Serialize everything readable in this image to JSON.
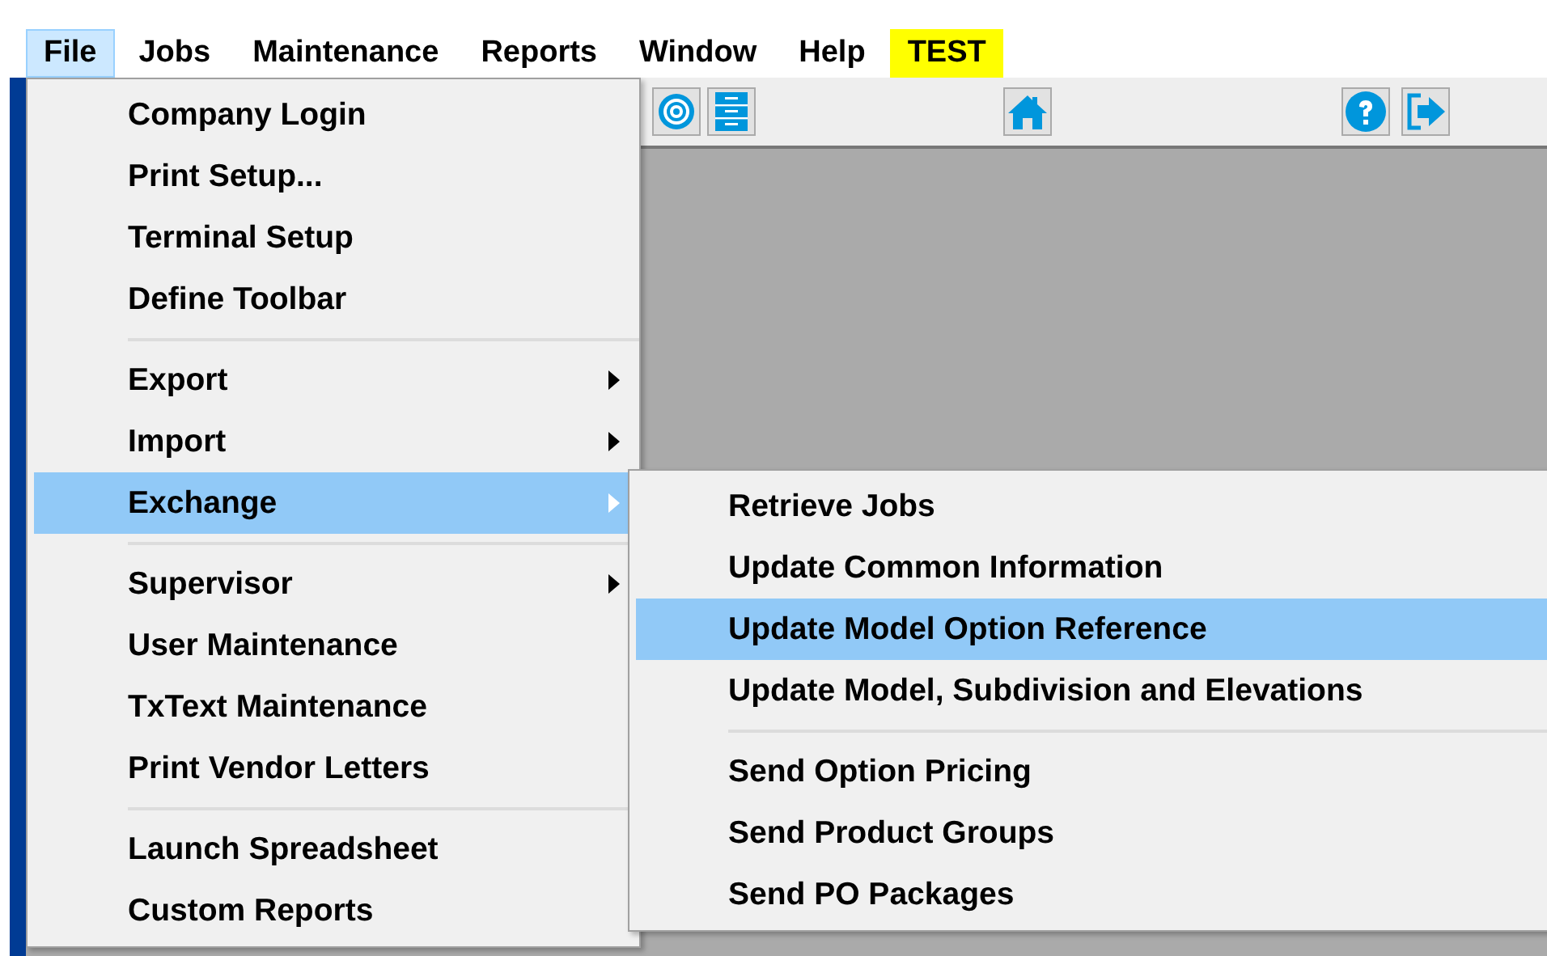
{
  "menubar": [
    {
      "label": "File",
      "selected": true,
      "kind": "menu"
    },
    {
      "label": "Jobs",
      "selected": false,
      "kind": "menu"
    },
    {
      "label": "Maintenance",
      "selected": false,
      "kind": "menu"
    },
    {
      "label": "Reports",
      "selected": false,
      "kind": "menu"
    },
    {
      "label": "Window",
      "selected": false,
      "kind": "menu"
    },
    {
      "label": "Help",
      "selected": false,
      "kind": "menu"
    },
    {
      "label": "TEST",
      "selected": false,
      "kind": "flag"
    }
  ],
  "file_menu": [
    {
      "kind": "item",
      "label": "Company Login",
      "submenu": false,
      "selected": false
    },
    {
      "kind": "item",
      "label": "Print Setup...",
      "submenu": false,
      "selected": false
    },
    {
      "kind": "item",
      "label": "Terminal Setup",
      "submenu": false,
      "selected": false
    },
    {
      "kind": "item",
      "label": "Define Toolbar",
      "submenu": false,
      "selected": false
    },
    {
      "kind": "separator"
    },
    {
      "kind": "item",
      "label": "Export",
      "submenu": true,
      "selected": false
    },
    {
      "kind": "item",
      "label": "Import",
      "submenu": true,
      "selected": false
    },
    {
      "kind": "item",
      "label": "Exchange",
      "submenu": true,
      "selected": true
    },
    {
      "kind": "separator"
    },
    {
      "kind": "item",
      "label": "Supervisor",
      "submenu": true,
      "selected": false
    },
    {
      "kind": "item",
      "label": "User Maintenance",
      "submenu": false,
      "selected": false
    },
    {
      "kind": "item",
      "label": "TxText Maintenance",
      "submenu": false,
      "selected": false
    },
    {
      "kind": "item",
      "label": "Print Vendor Letters",
      "submenu": false,
      "selected": false
    },
    {
      "kind": "separator"
    },
    {
      "kind": "item",
      "label": "Launch Spreadsheet",
      "submenu": false,
      "selected": false
    },
    {
      "kind": "item",
      "label": "Custom Reports",
      "submenu": false,
      "selected": false
    }
  ],
  "exchange_menu": [
    {
      "kind": "item",
      "label": "Retrieve Jobs",
      "selected": false
    },
    {
      "kind": "item",
      "label": "Update Common Information",
      "selected": false
    },
    {
      "kind": "item",
      "label": "Update Model Option Reference",
      "selected": true
    },
    {
      "kind": "item",
      "label": "Update Model, Subdivision and Elevations",
      "selected": false
    },
    {
      "kind": "separator"
    },
    {
      "kind": "item",
      "label": "Send Option Pricing",
      "selected": false
    },
    {
      "kind": "item",
      "label": "Send Product Groups",
      "selected": false
    },
    {
      "kind": "item",
      "label": "Send PO Packages",
      "selected": false
    }
  ]
}
